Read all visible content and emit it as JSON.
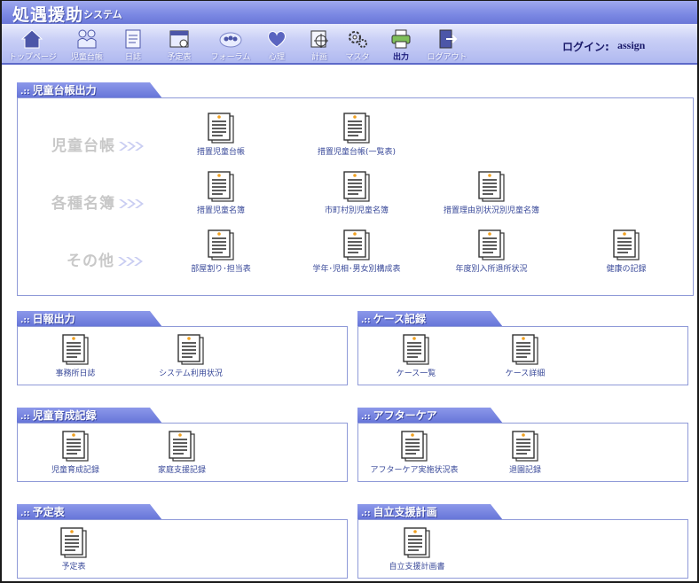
{
  "app": {
    "title": "処遇援助",
    "subtitle": "システム"
  },
  "nav": [
    {
      "id": "top",
      "label": "トップページ",
      "icon": "house-icon"
    },
    {
      "id": "child",
      "label": "児童台帳",
      "icon": "children-icon"
    },
    {
      "id": "diary",
      "label": "日誌",
      "icon": "notebook-icon"
    },
    {
      "id": "schedule",
      "label": "予定表",
      "icon": "calendar-icon"
    },
    {
      "id": "forum",
      "label": "フォーラム",
      "icon": "group-icon"
    },
    {
      "id": "psych",
      "label": "心理",
      "icon": "heart-icon"
    },
    {
      "id": "plan",
      "label": "計画",
      "icon": "target-icon"
    },
    {
      "id": "master",
      "label": "マスタ",
      "icon": "gear-icon"
    },
    {
      "id": "output",
      "label": "出力",
      "icon": "printer-icon",
      "active": true
    },
    {
      "id": "logout",
      "label": "ログアウト",
      "icon": "door-icon"
    }
  ],
  "login": {
    "label": "ログイン:",
    "user": "assign"
  },
  "sections": {
    "ledger": {
      "title": "児童台帳出力",
      "rows": [
        {
          "label": "児童台帳",
          "items": [
            "措置児童台帳",
            "措置児童台帳(一覧表)"
          ]
        },
        {
          "label": "各種名簿",
          "items": [
            "措置児童名簿",
            "市町村別児童名簿",
            "措置理由別状況別児童名簿"
          ]
        },
        {
          "label": "その他",
          "items": [
            "部屋割り･担当表",
            "学年･児相･男女別構成表",
            "年度別入所退所状況",
            "健康の記録"
          ]
        }
      ]
    },
    "daily": {
      "title": "日報出力",
      "items": [
        "事務所日誌",
        "システム利用状況"
      ]
    },
    "case": {
      "title": "ケース記録",
      "items": [
        "ケース一覧",
        "ケース詳細"
      ]
    },
    "growth": {
      "title": "児童育成記録",
      "items": [
        "児童育成記録",
        "家庭支援記録"
      ]
    },
    "aftercare": {
      "title": "アフターケア",
      "items": [
        "アフターケア実施状況表",
        "退園記録"
      ]
    },
    "schedule": {
      "title": "予定表",
      "items": [
        "予定表"
      ]
    },
    "independence": {
      "title": "自立支援計画",
      "items": [
        "自立支援計画書"
      ]
    }
  },
  "section_prefix": ".::",
  "colors": {
    "accent": "#6a77d8",
    "border": "#8f9ad8",
    "caption": "#3a4a9a"
  }
}
